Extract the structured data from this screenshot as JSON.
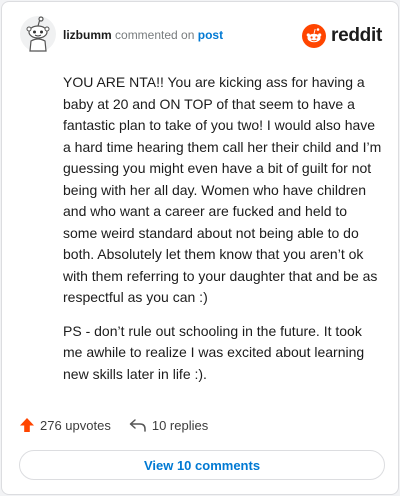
{
  "header": {
    "username": "lizbumm",
    "action": "commented on",
    "target": "post",
    "brand": "reddit",
    "avatar_icon": "snoo-avatar-icon",
    "logo_icon": "reddit-logo-icon",
    "brand_color": "#ff4500"
  },
  "comment": {
    "paragraphs": [
      "YOU ARE NTA!! You are kicking ass for having a baby at 20 and ON TOP of that seem to have a fantastic plan to take of you two! I would also have a hard time hearing them call her their child and I’m guessing you might even have a bit of guilt for not being with her all day. Women who have children and who want a career are fucked and held to some weird standard about not being able to do both. Absolutely let them know that you aren’t ok with them referring to your daughter that and be as respectful as you can :)",
      "PS - don’t rule out schooling in the future. It took me awhile to realize I was excited about learning new skills later in life :)."
    ]
  },
  "stats": {
    "upvotes": "276 upvotes",
    "upvote_icon": "upvote-arrow-icon",
    "replies": "10 replies",
    "reply_icon": "reply-arrow-icon"
  },
  "footer": {
    "view_label": "View 10 comments"
  },
  "colors": {
    "link": "#0079d3",
    "upvote": "#ff4500",
    "muted": "#787c7e"
  }
}
